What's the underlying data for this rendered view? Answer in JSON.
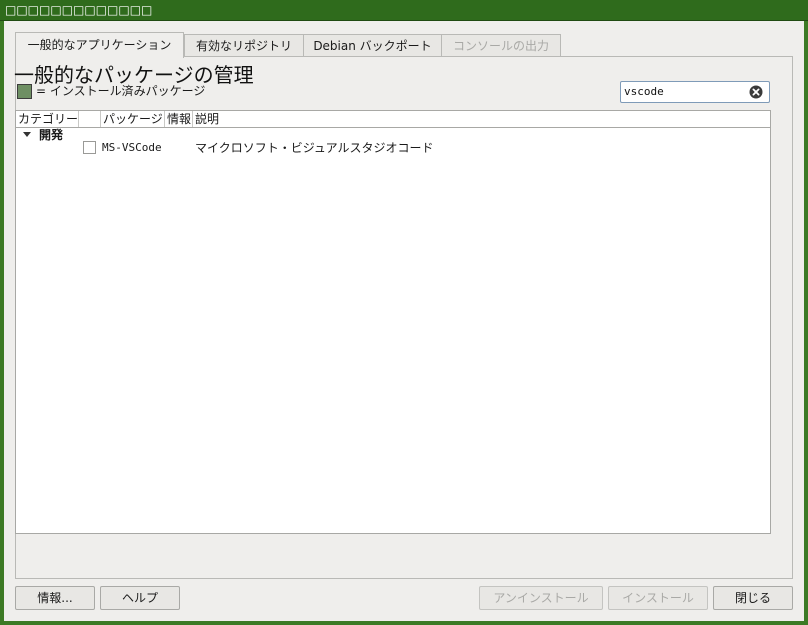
{
  "window": {
    "title": "□□□□□□□□□□□□□"
  },
  "tabs": [
    {
      "label": "一般的なアプリケーション",
      "active": true,
      "enabled": true
    },
    {
      "label": "有効なリポジトリ",
      "active": false,
      "enabled": true
    },
    {
      "label": "Debian バックポート",
      "active": false,
      "enabled": true
    },
    {
      "label": "コンソールの出力",
      "active": false,
      "enabled": false
    }
  ],
  "main": {
    "heading": "一般的なパッケージの管理",
    "legend": {
      "text": "= インストール済みパッケージ",
      "swatch_color": "#6e8f63"
    },
    "search": {
      "value": "vscode",
      "clear_icon": "clear-circle-icon"
    }
  },
  "table": {
    "columns": [
      "カテゴリー",
      "",
      "パッケージ",
      "情報",
      "説明"
    ],
    "groups": [
      {
        "name": "開発",
        "expanded": true,
        "rows": [
          {
            "installed": false,
            "package": "MS-VSCode",
            "info": "",
            "description": "マイクロソフト・ビジュアルスタジオコード"
          }
        ]
      }
    ]
  },
  "buttons": {
    "info": "情報...",
    "help": "ヘルプ",
    "uninstall": "アンインストール",
    "install": "インストール",
    "close": "閉じる"
  },
  "colors": {
    "titlebar": "#2f6b1c",
    "frame": "#3c7a25",
    "installed": "#6e8f63"
  }
}
